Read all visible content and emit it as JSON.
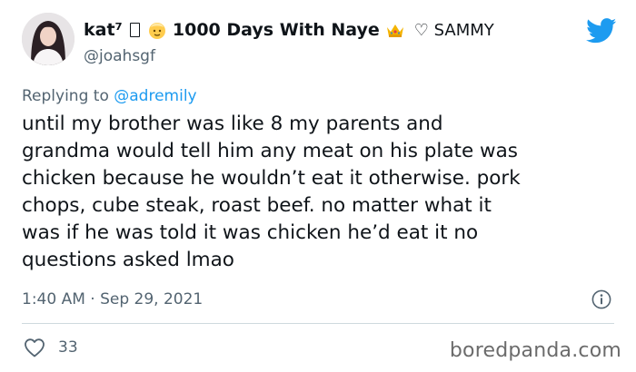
{
  "tweet": {
    "author": {
      "name_part1": "kat⁷",
      "name_part2": "1000 Days With Naye",
      "name_part3": "♡ SAMMY",
      "handle": "@joahsgf"
    },
    "replying_prefix": "Replying to ",
    "replying_to": "@adremily",
    "body": "until my brother was like 8 my parents and\ngrandma would tell him any meat on his plate was\nchicken because he wouldn’t eat it otherwise. pork\nchops, cube steak, roast beef. no matter what it\nwas if he was told it was chicken he’d eat it no\nquestions asked lmao",
    "timestamp": "1:40 AM · Sep 29, 2021",
    "likes": "33"
  },
  "watermark": "boredpanda.com",
  "icons": {
    "brand": "twitter-bird-icon",
    "info": "info-icon",
    "like": "heart-icon"
  },
  "colors": {
    "twitter_blue": "#1d9bf0",
    "secondary_text": "#536471",
    "divider": "#cfd9de"
  }
}
